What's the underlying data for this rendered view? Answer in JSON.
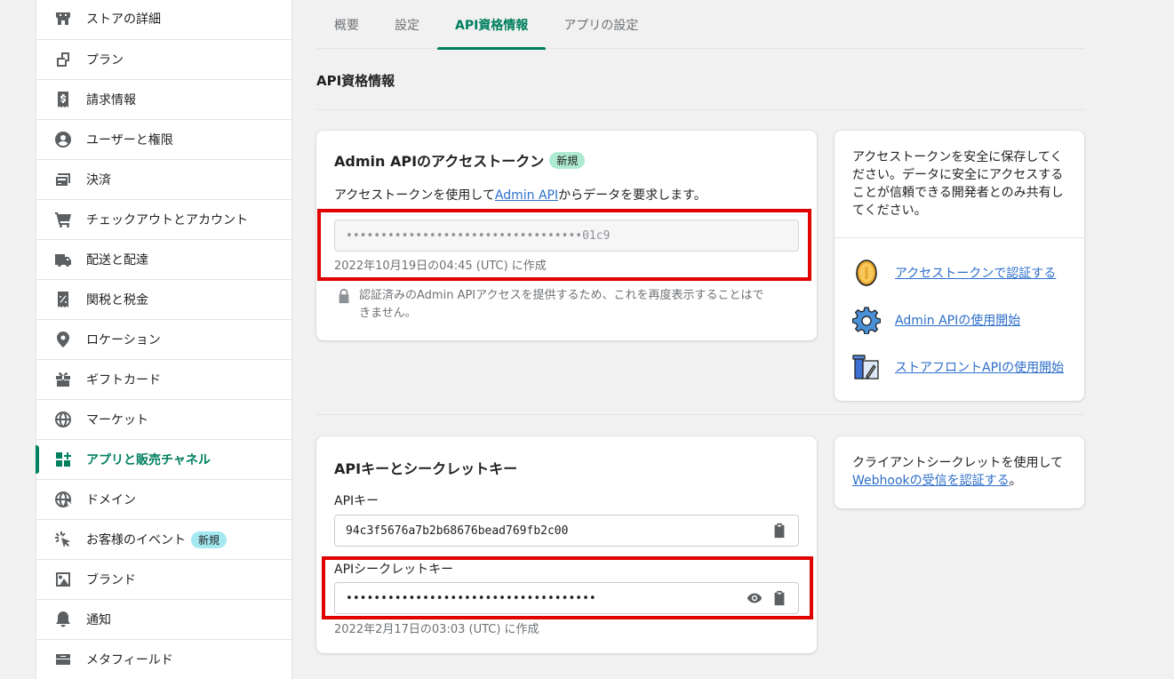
{
  "sidebar": {
    "items": [
      {
        "label": "ストアの詳細",
        "icon": "store-icon"
      },
      {
        "label": "プラン",
        "icon": "plan-icon"
      },
      {
        "label": "請求情報",
        "icon": "billing-icon"
      },
      {
        "label": "ユーザーと権限",
        "icon": "user-icon"
      },
      {
        "label": "決済",
        "icon": "payment-icon"
      },
      {
        "label": "チェックアウトとアカウント",
        "icon": "cart-icon"
      },
      {
        "label": "配送と配達",
        "icon": "truck-icon"
      },
      {
        "label": "関税と税金",
        "icon": "tax-icon"
      },
      {
        "label": "ロケーション",
        "icon": "location-icon"
      },
      {
        "label": "ギフトカード",
        "icon": "gift-icon"
      },
      {
        "label": "マーケット",
        "icon": "globe-icon"
      },
      {
        "label": "アプリと販売チャネル",
        "icon": "apps-icon"
      },
      {
        "label": "ドメイン",
        "icon": "domain-icon"
      },
      {
        "label": "お客様のイベント",
        "icon": "cursor-icon",
        "badge": "新規"
      },
      {
        "label": "ブランド",
        "icon": "brand-icon"
      },
      {
        "label": "通知",
        "icon": "bell-icon"
      },
      {
        "label": "メタフィールド",
        "icon": "metafield-icon"
      }
    ]
  },
  "tabs": [
    {
      "label": "概要"
    },
    {
      "label": "設定"
    },
    {
      "label": "API資格情報"
    },
    {
      "label": "アプリの設定"
    }
  ],
  "section_title": "API資格情報",
  "admin_card": {
    "title": "Admin APIのアクセストークン",
    "badge": "新規",
    "desc_prefix": "アクセストークンを使用して",
    "desc_link": "Admin API",
    "desc_suffix": "からデータを要求します。",
    "token_value": "••••••••••••••••••••••••••••••••••01c9",
    "created": "2022年10月19日の04:45 (UTC) に作成",
    "notice_line1": "認証済みのAdmin APIアクセスを提供するため、これを再度表示することはで",
    "notice_line2": "きません。"
  },
  "admin_side": {
    "text": "アクセストークンを安全に保存してください。データに安全にアクセスすることが信頼できる開発者とのみ共有してください。",
    "links": [
      {
        "label": "アクセストークンで認証する",
        "icon": "coin-icon"
      },
      {
        "label": "Admin APIの使用開始",
        "icon": "gear-icon"
      },
      {
        "label": "ストアフロントAPIの使用開始",
        "icon": "blueprint-icon"
      }
    ]
  },
  "keys_card": {
    "title": "APIキーとシークレットキー",
    "api_key_label": "APIキー",
    "api_key_value": "94c3f5676a7b2b68676bead769fb2c00",
    "secret_label": "APIシークレットキー",
    "secret_value": "••••••••••••••••••••••••••••••••••••",
    "created": "2022年2月17日の03:03 (UTC) に作成"
  },
  "keys_side": {
    "text": "クライアントシークレットを使用して",
    "link": "Webhookの受信を認証する",
    "suffix": "。"
  },
  "colors": {
    "accent": "#008060",
    "link": "#2c6ecb",
    "highlight": "#e00000"
  }
}
